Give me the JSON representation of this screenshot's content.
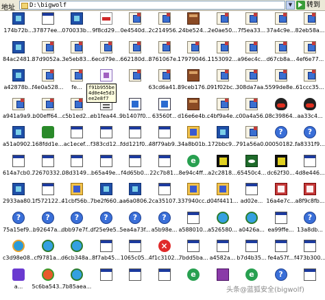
{
  "address_bar": {
    "label": "地址",
    "path": "D:\\bigwolf",
    "go_label": "转到"
  },
  "tooltip": {
    "text": "f91b955be4d0e4e5d3ee2e8f7"
  },
  "watermark": "头条@蓝狐安全(bigwolf)",
  "rows": [
    [
      {
        "label": "174b72b...",
        "icon": "ms-icon"
      },
      {
        "label": "37877ee...",
        "icon": "win-icon"
      },
      {
        "label": "070033b...",
        "icon": "ms-icon"
      },
      {
        "label": "9f8cd29...",
        "icon": "file-icon"
      },
      {
        "label": "0e4540d...",
        "icon": "env-icon"
      },
      {
        "label": "2c214956...",
        "icon": "env-icon"
      },
      {
        "label": "24be524...",
        "icon": "book-icon"
      },
      {
        "label": "2e0ae50...",
        "icon": "env-icon"
      },
      {
        "label": "7f5ea33...",
        "icon": "env-icon"
      },
      {
        "label": "37a4c9e...",
        "icon": "env-icon"
      },
      {
        "label": "82eb58a...",
        "icon": "env-icon"
      }
    ],
    [
      {
        "label": "84ac2481...",
        "icon": "ms-icon"
      },
      {
        "label": "87d9052a...",
        "icon": "env-icon"
      },
      {
        "label": "3e5eb83...",
        "icon": "env-icon"
      },
      {
        "label": "6ecd79e...",
        "icon": "env-icon"
      },
      {
        "label": "662180d...",
        "icon": "env-icon"
      },
      {
        "label": "8761067e...",
        "icon": "env-icon"
      },
      {
        "label": "17979046...",
        "icon": "env-icon"
      },
      {
        "label": "1153092...",
        "icon": "env-icon"
      },
      {
        "label": "a96ec4c...",
        "icon": "env-icon"
      },
      {
        "label": "d67cb8a...",
        "icon": "env-icon"
      },
      {
        "label": "4ef6e77...",
        "icon": "env-icon"
      }
    ],
    [
      {
        "label": "a42878b...",
        "icon": "ms-icon"
      },
      {
        "label": "f4e0a528...",
        "icon": "env-icon"
      },
      {
        "label": "fe...",
        "icon": "env-icon"
      },
      {
        "label": "",
        "icon": "doc-icon"
      },
      {
        "label": "",
        "icon": "env-icon"
      },
      {
        "label": "63cd6a41...",
        "icon": "env-icon"
      },
      {
        "label": "89ceb176...",
        "icon": "book-icon"
      },
      {
        "label": "091f02bc...",
        "icon": "env-icon"
      },
      {
        "label": "308da7aa...",
        "icon": "env-icon"
      },
      {
        "label": "5599de8e...",
        "icon": "env-icon"
      },
      {
        "label": "61ccc35...",
        "icon": "env-icon"
      }
    ],
    [
      {
        "label": "a941a9a9...",
        "icon": "env-icon"
      },
      {
        "label": "b00eff64...",
        "icon": "env-icon"
      },
      {
        "label": "c5b1ed2...",
        "icon": "env-icon"
      },
      {
        "label": "eb1fea44...",
        "icon": "dll-icon"
      },
      {
        "label": "9b1407f0...",
        "icon": "film-icon"
      },
      {
        "label": "63560f...",
        "icon": "film-icon"
      },
      {
        "label": "d16e6e4b...",
        "icon": "book-icon"
      },
      {
        "label": "c4bf9a4e...",
        "icon": "env-icon"
      },
      {
        "label": "c00a4a56...",
        "icon": "env-icon"
      },
      {
        "label": "08c39864...",
        "icon": "qq-icon"
      },
      {
        "label": "aa33c4...",
        "icon": "qq-icon"
      }
    ],
    [
      {
        "label": "a51a0902...",
        "icon": "ms-icon"
      },
      {
        "label": "168fdd1e...",
        "icon": "tree-icon"
      },
      {
        "label": "ac1ecef...",
        "icon": "win-icon"
      },
      {
        "label": "f383cd12...",
        "icon": "win-icon"
      },
      {
        "label": "fdd121f0...",
        "icon": "win-icon"
      },
      {
        "label": "48f79ab9...",
        "icon": "win-icon"
      },
      {
        "label": "34a8b01b...",
        "icon": "pkg-icon"
      },
      {
        "label": "172bbc9...",
        "icon": "ms-icon"
      },
      {
        "label": "791a56a0...",
        "icon": "env-icon"
      },
      {
        "label": "00050182...",
        "icon": "help-icon"
      },
      {
        "label": "fa8331f9...",
        "icon": "help-icon"
      }
    ],
    [
      {
        "label": "614a7cb0...",
        "icon": "win-icon"
      },
      {
        "label": "72670332...",
        "icon": "win-icon"
      },
      {
        "label": "08d3149...",
        "icon": "win-icon"
      },
      {
        "label": "b65a49e...",
        "icon": "win-icon"
      },
      {
        "label": "f4d65b0...",
        "icon": "win-icon"
      },
      {
        "label": "22c7b81...",
        "icon": "win-icon"
      },
      {
        "label": "8e94c4ff...",
        "icon": "green-icon"
      },
      {
        "label": "a2c2818...",
        "icon": "qr-icon"
      },
      {
        "label": "65450c4...",
        "icon": "eye-icon"
      },
      {
        "label": "dc62f30...",
        "icon": "qr-icon"
      },
      {
        "label": "4d8e446...",
        "icon": "win-icon"
      }
    ],
    [
      {
        "label": "2933aa80...",
        "icon": "ms-icon"
      },
      {
        "label": "1f572122...",
        "icon": "win-icon"
      },
      {
        "label": "41cbf56b...",
        "icon": "pkg-icon"
      },
      {
        "label": "7be2f660...",
        "icon": "ms-icon"
      },
      {
        "label": "aa6a0806...",
        "icon": "ms-icon"
      },
      {
        "label": "2ca35107...",
        "icon": "win-icon"
      },
      {
        "label": "337940cc...",
        "icon": "pkg-icon"
      },
      {
        "label": "d04f4411...",
        "icon": "pkg-icon"
      },
      {
        "label": "ad02e...",
        "icon": "win-icon"
      },
      {
        "label": "16a4e7c...",
        "icon": "img-icon"
      },
      {
        "label": "a8f9c8fb...",
        "icon": "img-icon"
      }
    ],
    [
      {
        "label": "75a15ef9...",
        "icon": "help-icon"
      },
      {
        "label": "b92647a...",
        "icon": "help-icon"
      },
      {
        "label": "dbb97e7f...",
        "icon": "help-icon"
      },
      {
        "label": "df25e9e5...",
        "icon": "help-icon"
      },
      {
        "label": "5ea4a73f...",
        "icon": "help-icon"
      },
      {
        "label": "a5b98e...",
        "icon": "help-icon"
      },
      {
        "label": "a588010...",
        "icon": "win-icon"
      },
      {
        "label": "a526580...",
        "icon": "media-icon"
      },
      {
        "label": "a0426a...",
        "icon": "media-icon"
      },
      {
        "label": "ea99ffe...",
        "icon": "win-icon"
      },
      {
        "label": "13a8db...",
        "icon": "help-icon"
      }
    ],
    [
      {
        "label": "c3d98e08...",
        "icon": "ie-icon"
      },
      {
        "label": "cf9781a...",
        "icon": "media-icon"
      },
      {
        "label": "d6cb348a...",
        "icon": "media-icon"
      },
      {
        "label": "8f7ab45...",
        "icon": "win-icon"
      },
      {
        "label": "1065c05...",
        "icon": "win-icon"
      },
      {
        "label": "4f1c3102...",
        "icon": "cross-icon"
      },
      {
        "label": "7bdd5ba...",
        "icon": "win-icon"
      },
      {
        "label": "a4582a...",
        "icon": "win-icon"
      },
      {
        "label": "b7d4b35...",
        "icon": "win-icon"
      },
      {
        "label": "fe4a57f...",
        "icon": "win-icon"
      },
      {
        "label": "f473b300...",
        "icon": "win-icon"
      }
    ],
    [
      {
        "label": "a...",
        "icon": "burst-icon"
      },
      {
        "label": "5c6ba543...",
        "icon": "ball-icon"
      },
      {
        "label": "7b85aea...",
        "icon": "media-icon"
      },
      {
        "label": "",
        "icon": "win-icon"
      },
      {
        "label": "",
        "icon": "win-icon"
      },
      {
        "label": "",
        "icon": "win-icon"
      },
      {
        "label": "",
        "icon": "green-icon"
      },
      {
        "label": "",
        "icon": "rar-icon"
      },
      {
        "label": "",
        "icon": "green-icon"
      },
      {
        "label": "",
        "icon": "help-icon"
      },
      {
        "label": "",
        "icon": "win-icon"
      }
    ]
  ]
}
